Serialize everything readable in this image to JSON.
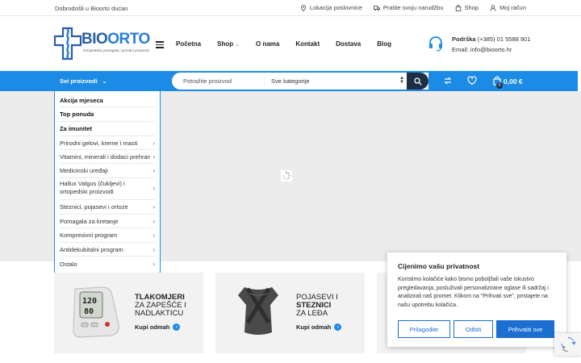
{
  "topbar": {
    "welcome": "Dobrodošli u Bioorto dućan",
    "links": [
      "Lokacija poslovnice",
      "Pratite svoju narudžbu",
      "Shop",
      "Moj račun"
    ]
  },
  "logo": {
    "name_part1": "BIO",
    "name_part2": "ORTO",
    "tagline": "Ortopedska pomagala i prirodni preparati"
  },
  "nav": {
    "items": [
      "Početna",
      "Shop",
      "O nama",
      "Kontakt",
      "Dostava",
      "Blog"
    ]
  },
  "support": {
    "label": "Podrška",
    "phone": "(+385) 01 5588 901",
    "email": "Email: info@bioorto.hr"
  },
  "bluebar": {
    "categories_label": "Svi proizvodi",
    "search_placeholder": "Potražite proizvod",
    "search_category": "Sve kategorije",
    "cart_total": "0,00 €",
    "cart_count": "0"
  },
  "categories": [
    {
      "label": "Akcija mjeseca",
      "bold": true,
      "chevron": false
    },
    {
      "label": "Top ponuda",
      "bold": true,
      "chevron": false
    },
    {
      "label": "Za imunitet",
      "bold": true,
      "chevron": false
    },
    {
      "label": "Prirodni gelovi, kreme i masti",
      "bold": false,
      "chevron": true
    },
    {
      "label": "Vitamini, minerali i dodaci prehrani",
      "bold": false,
      "chevron": true
    },
    {
      "label": "Medicinski uređaji",
      "bold": false,
      "chevron": true
    },
    {
      "label": "Hallux Valgus (čukljevi) i ortopedski proizvodi",
      "bold": false,
      "chevron": true
    },
    {
      "label": "Steznici, pojasevi i ortoze",
      "bold": false,
      "chevron": true
    },
    {
      "label": "Pomagala za kretanje",
      "bold": false,
      "chevron": true
    },
    {
      "label": "Kompresivni program",
      "bold": false,
      "chevron": true
    },
    {
      "label": "Antidekubitalni program",
      "bold": false,
      "chevron": true
    },
    {
      "label": "Ostalo",
      "bold": false,
      "chevron": true
    }
  ],
  "promos": [
    {
      "bold_line": "TLAKOMJERI",
      "line2": "ZA ZAPEŠĆE I",
      "line3": "NADLAKTICU",
      "cta": "Kupi odmah"
    },
    {
      "line1": "POJASEVI I",
      "bold_line": "STEZNICI",
      "line3": "ZA LEĐA",
      "cta": "Kupi odmah"
    }
  ],
  "cookie": {
    "title": "Cijenimo vašu privatnost",
    "text": "Koristimo kolačiće kako bismo poboljšali vaše iskustvo pregledavanja, posluživali personalizirane oglase ili sadržaj i analizirali naš promet. Klikom na \"Prihvati sve\", pristajete na našu upotrebu kolačića.",
    "customize": "Prilagodite",
    "reject": "Odbiti",
    "accept": "Prihvatiti sve"
  },
  "colors": {
    "brand_blue": "#1b8be5",
    "dark_navy": "#1e2f44",
    "cookie_blue": "#1b6fd0"
  }
}
